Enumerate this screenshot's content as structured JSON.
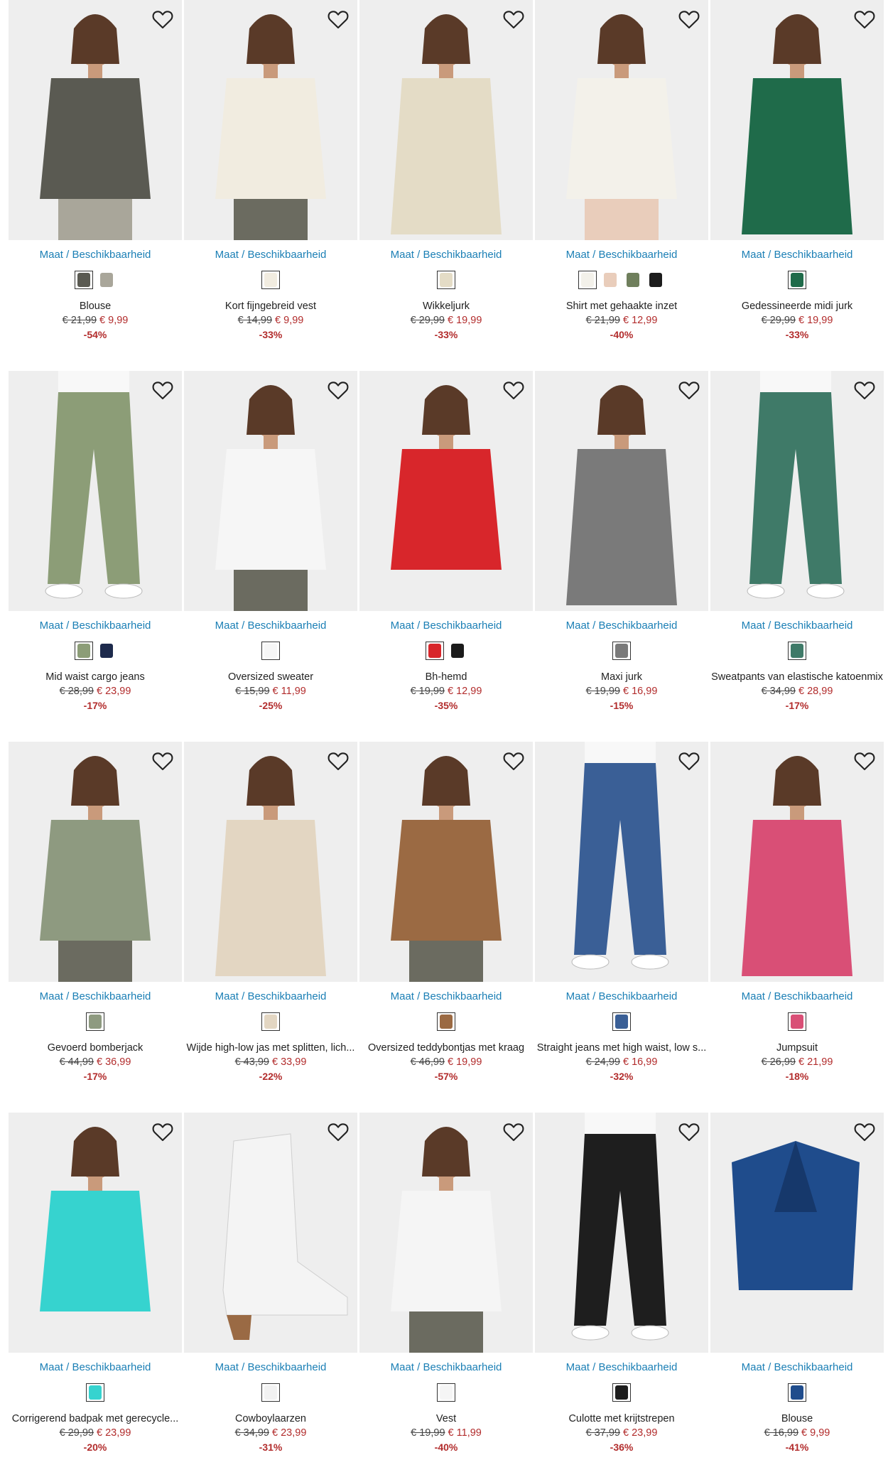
{
  "ui": {
    "size_label": "Maat / Beschikbaarheid",
    "wishlist_icon": "heart-outline-icon"
  },
  "products": [
    {
      "name": "Blouse",
      "old_price": "€ 21,99",
      "new_price": "€ 9,99",
      "discount": "-54%",
      "image": "woman-floral-blouse",
      "colors": [
        "#5a5a52",
        "#a9a69a"
      ],
      "bg": "#eeeeee"
    },
    {
      "name": "Kort fijngebreid vest",
      "old_price": "€ 14,99",
      "new_price": "€ 9,99",
      "discount": "-33%",
      "image": "woman-cream-cardigan",
      "colors": [
        "#f1ece0"
      ],
      "bg": "#eeeeee"
    },
    {
      "name": "Wikkeljurk",
      "old_price": "€ 29,99",
      "new_price": "€ 19,99",
      "discount": "-33%",
      "image": "woman-beige-wrap-dress",
      "colors": [
        "#e4dcc6"
      ],
      "bg": "#eeeeee"
    },
    {
      "name": "Shirt met gehaakte inzet",
      "old_price": "€ 21,99",
      "new_price": "€ 12,99",
      "discount": "-40%",
      "image": "woman-white-crochet-shirt",
      "colors": [
        "#f3f1ea",
        "#e9cdbb",
        "#6f7f5c",
        "#1c1c1c"
      ],
      "bg": "#eeeeee"
    },
    {
      "name": "Gedessineerde midi jurk",
      "old_price": "€ 29,99",
      "new_price": "€ 19,99",
      "discount": "-33%",
      "image": "woman-green-print-dress",
      "colors": [
        "#1f6b4a"
      ],
      "bg": "#eeeeee"
    },
    {
      "name": "Mid waist cargo jeans",
      "old_price": "€ 28,99",
      "new_price": "€ 23,99",
      "discount": "-17%",
      "image": "sage-cargo-pants",
      "colors": [
        "#8c9d77",
        "#1d2a4c"
      ],
      "bg": "#eeeeee"
    },
    {
      "name": "Oversized sweater",
      "old_price": "€ 15,99",
      "new_price": "€ 11,99",
      "discount": "-25%",
      "image": "woman-white-sweater",
      "colors": [
        "#f6f6f6"
      ],
      "bg": "#eeeeee"
    },
    {
      "name": "Bh-hemd",
      "old_price": "€ 19,99",
      "new_price": "€ 12,99",
      "discount": "-35%",
      "image": "woman-red-lace-bodysuit",
      "colors": [
        "#d8262b",
        "#1b1b1b"
      ],
      "bg": "#eeeeee"
    },
    {
      "name": "Maxi jurk",
      "old_price": "€ 19,99",
      "new_price": "€ 16,99",
      "discount": "-15%",
      "image": "woman-striped-maxi-dress",
      "colors": [
        "#7a7a7a"
      ],
      "bg": "#eeeeee"
    },
    {
      "name": "Sweatpants van elastische katoenmix",
      "old_price": "€ 34,99",
      "new_price": "€ 28,99",
      "discount": "-17%",
      "image": "green-sweatpants",
      "colors": [
        "#3f7a68"
      ],
      "bg": "#eeeeee"
    },
    {
      "name": "Gevoerd bomberjack",
      "old_price": "€ 44,99",
      "new_price": "€ 36,99",
      "discount": "-17%",
      "image": "woman-olive-bomber-jacket",
      "colors": [
        "#8e9a80"
      ],
      "bg": "#eeeeee"
    },
    {
      "name": "Wijde high-low jas met splitten, lich...",
      "old_price": "€ 43,99",
      "new_price": "€ 33,99",
      "discount": "-22%",
      "image": "woman-beige-parka",
      "colors": [
        "#e3d6c2"
      ],
      "bg": "#eeeeee"
    },
    {
      "name": "Oversized teddybontjas met kraag",
      "old_price": "€ 46,99",
      "new_price": "€ 19,99",
      "discount": "-57%",
      "image": "woman-brown-teddy-jacket",
      "colors": [
        "#9b6a43"
      ],
      "bg": "#eeeeee"
    },
    {
      "name": "Straight jeans met high waist, low s...",
      "old_price": "€ 24,99",
      "new_price": "€ 16,99",
      "discount": "-32%",
      "image": "blue-straight-jeans",
      "colors": [
        "#3a5f96"
      ],
      "bg": "#eeeeee"
    },
    {
      "name": "Jumpsuit",
      "old_price": "€ 26,99",
      "new_price": "€ 21,99",
      "discount": "-18%",
      "image": "woman-pink-print-jumpsuit",
      "colors": [
        "#d94f76"
      ],
      "bg": "#eeeeee"
    },
    {
      "name": "Corrigerend badpak met gerecycle...",
      "old_price": "€ 29,99",
      "new_price": "€ 23,99",
      "discount": "-20%",
      "image": "woman-turquoise-swimsuit",
      "colors": [
        "#36d3cf"
      ],
      "bg": "#eeeeee"
    },
    {
      "name": "Cowboylaarzen",
      "old_price": "€ 34,99",
      "new_price": "€ 23,99",
      "discount": "-31%",
      "image": "white-cowboy-boot",
      "colors": [
        "#f2f2f2"
      ],
      "bg": "#eeeeee"
    },
    {
      "name": "Vest",
      "old_price": "€ 19,99",
      "new_price": "€ 11,99",
      "discount": "-40%",
      "image": "woman-white-black-trim-cardigan",
      "colors": [
        "#f5f5f5"
      ],
      "bg": "#eeeeee"
    },
    {
      "name": "Culotte met krijtstrepen",
      "old_price": "€ 37,99",
      "new_price": "€ 23,99",
      "discount": "-36%",
      "image": "black-pinstripe-culotte",
      "colors": [
        "#1e1e1e"
      ],
      "bg": "#eeeeee"
    },
    {
      "name": "Blouse",
      "old_price": "€ 16,99",
      "new_price": "€ 9,99",
      "discount": "-41%",
      "image": "blue-chiffon-blouse",
      "colors": [
        "#1f4c8c"
      ],
      "bg": "#eeeeee"
    }
  ]
}
